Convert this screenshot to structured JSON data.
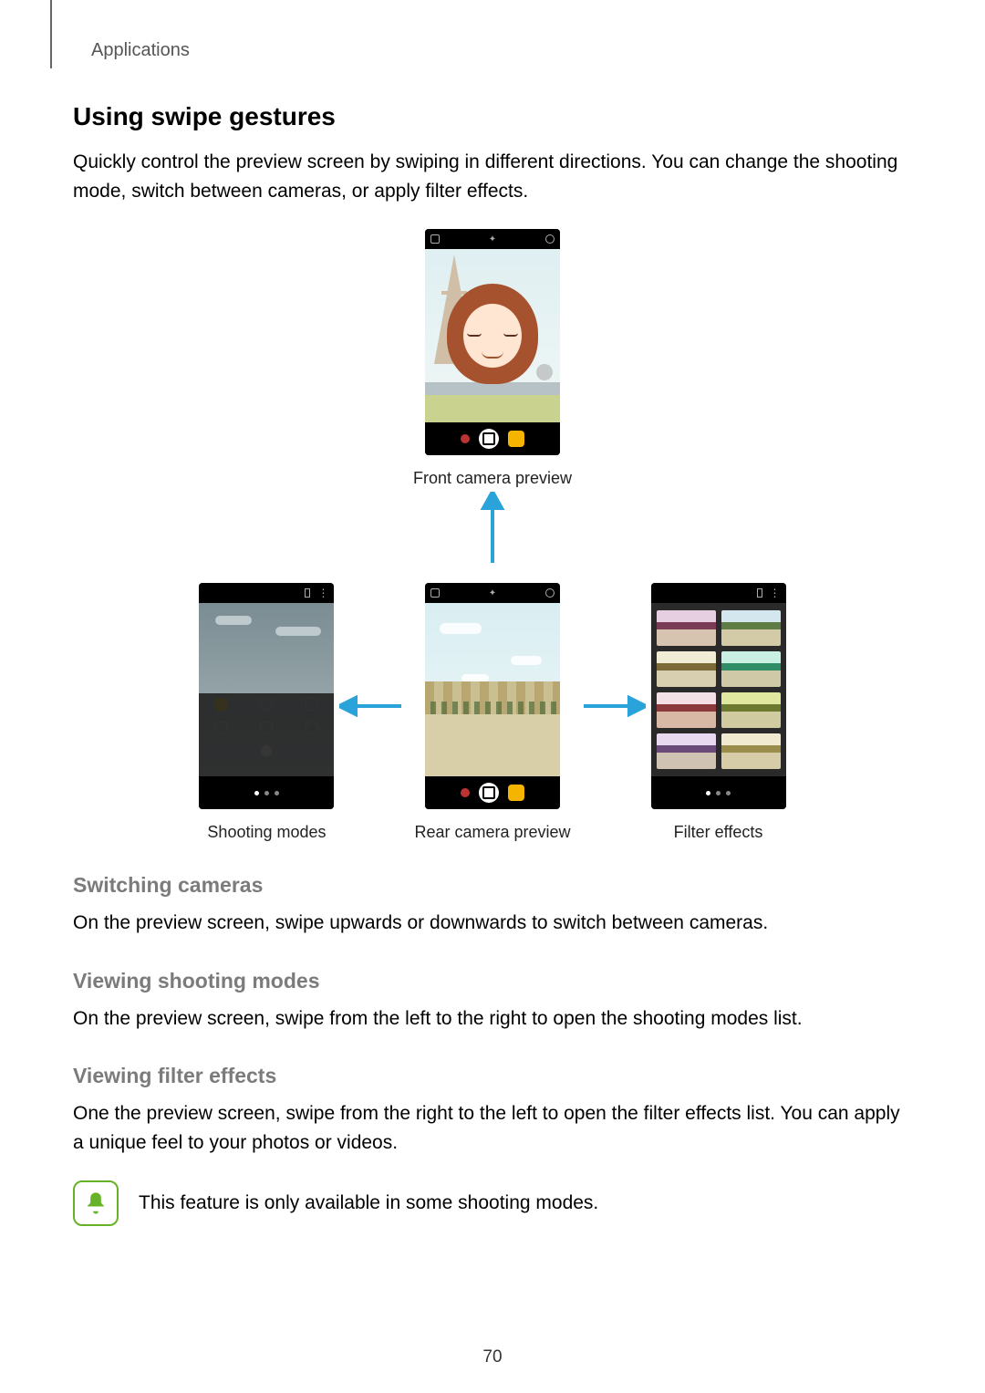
{
  "breadcrumb": "Applications",
  "heading": "Using swipe gestures",
  "intro": "Quickly control the preview screen by swiping in different directions. You can change the shooting mode, switch between cameras, or apply filter effects.",
  "captions": {
    "front": "Front camera preview",
    "modes": "Shooting modes",
    "rear": "Rear camera preview",
    "filters": "Filter effects"
  },
  "sections": {
    "switch_h": "Switching cameras",
    "switch_p": "On the preview screen, swipe upwards or downwards to switch between cameras.",
    "modes_h": "Viewing shooting modes",
    "modes_p": "On the preview screen, swipe from the left to the right to open the shooting modes list.",
    "filters_h": "Viewing filter effects",
    "filters_p": "One the preview screen, swipe from the right to the left to open the filter effects list. You can apply a unique feel to your photos or videos."
  },
  "note": "This feature is only available in some shooting modes.",
  "page_number": "70"
}
